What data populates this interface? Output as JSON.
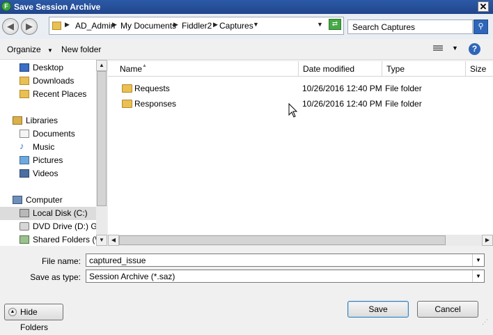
{
  "window": {
    "title": "Save Session Archive",
    "app_glyph": "F"
  },
  "nav_buttons": {
    "back": "◀",
    "forward": "▶"
  },
  "breadcrumb": [
    "AD_Admin",
    "My Documents",
    "Fiddler2",
    "Captures"
  ],
  "search": {
    "value": "Search Captures"
  },
  "toolbar": {
    "organize": "Organize",
    "new_folder": "New folder"
  },
  "sidebar": {
    "items": [
      {
        "label": "Desktop",
        "icon": "desktop-icon"
      },
      {
        "label": "Downloads",
        "icon": "downloads-icon"
      },
      {
        "label": "Recent Places",
        "icon": "recent-places-icon"
      },
      {
        "label": "Libraries",
        "icon": "libraries-icon"
      },
      {
        "label": "Documents",
        "icon": "documents-icon"
      },
      {
        "label": "Music",
        "icon": "music-icon"
      },
      {
        "label": "Pictures",
        "icon": "pictures-icon"
      },
      {
        "label": "Videos",
        "icon": "videos-icon"
      },
      {
        "label": "Computer",
        "icon": "computer-icon"
      },
      {
        "label": "Local Disk (C:)",
        "icon": "local-disk-icon"
      },
      {
        "label": "DVD Drive (D:) GRM",
        "icon": "dvd-drive-icon"
      },
      {
        "label": "Shared Folders (\\\\v",
        "icon": "shared-folders-icon"
      }
    ]
  },
  "columns": [
    "Name",
    "Date modified",
    "Type",
    "Size"
  ],
  "files": [
    {
      "name": "Requests",
      "date": "10/26/2016 12:40 PM",
      "type": "File folder"
    },
    {
      "name": "Responses",
      "date": "10/26/2016 12:40 PM",
      "type": "File folder"
    }
  ],
  "form": {
    "filename_label": "File name:",
    "filename_value": "captured_issue",
    "type_label": "Save as type:",
    "type_value": "Session Archive (*.saz)"
  },
  "buttons": {
    "hide_folders": "Hide Folders",
    "save": "Save",
    "cancel": "Cancel"
  },
  "colors": {
    "titlebar": "#2c5aa6",
    "folder": "#e8c055",
    "selection": "#dcdcdc"
  }
}
